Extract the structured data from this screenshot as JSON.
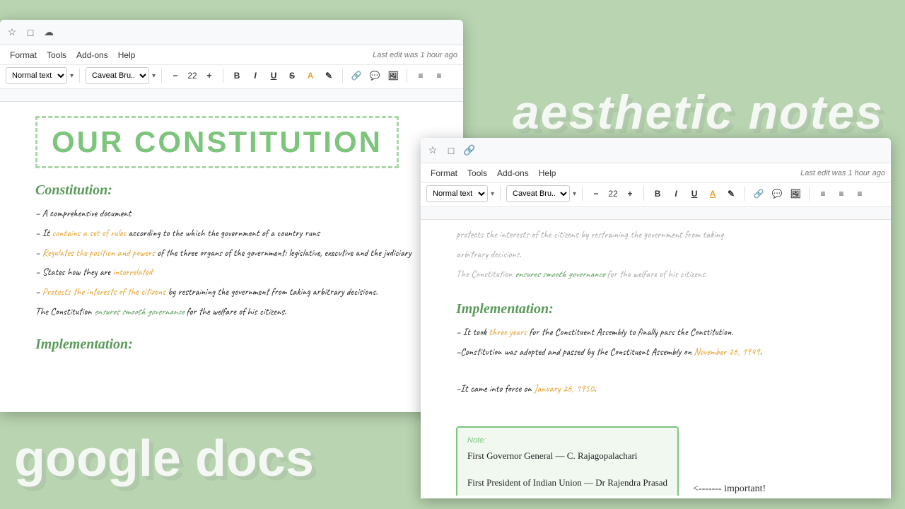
{
  "background": {
    "color": "#b8d4b0"
  },
  "decorative": {
    "aesthetic_notes": "aesthetic notes",
    "google_docs": "google docs",
    "arrow": "↗"
  },
  "window1": {
    "toolbar_icons": [
      "☆",
      "□",
      "☁"
    ],
    "menu_items": [
      "Format",
      "Tools",
      "Add-ons",
      "Help"
    ],
    "last_edit": "Last edit was 1 hour ago",
    "style_selector": "Normal text",
    "font_selector": "Caveat Bru...",
    "font_size": "22",
    "title": "OUR CONSTITUTION",
    "sections": [
      {
        "heading": "Constitution:",
        "content": [
          "– A comprehensive document",
          "– It {contains a set of rules} according to the which the government of a country runs",
          "– {Regulates the position and powers} of the three organs of the government: legislative, executive and the judiciary",
          "– States how they are {interrelated}",
          "– {Protects the interests of the citizens} by restraining the government from taking arbitrary decisions.",
          "The Constitution {ensures smooth governance} for the welfare of his citizens."
        ]
      },
      {
        "heading": "Implementation:"
      }
    ]
  },
  "window2": {
    "toolbar_icons": [
      "☆",
      "□",
      "🔗"
    ],
    "menu_items": [
      "Format",
      "Tools",
      "Add-ons",
      "Help"
    ],
    "last_edit": "Last edit was 1 hour ago",
    "style_selector": "Normal text",
    "font_selector": "Caveat Bru...",
    "font_size": "22",
    "sections": [
      {
        "heading": "Implementation:",
        "content": [
          "– It took {three years} for the Constituent Assembly to finally pass the Constitution.",
          "–Constitution was adopted and passed by the Constituent Assembly on {November 26, 1949}.",
          "–It came into force on {January 26, 1950}."
        ]
      }
    ],
    "note_box": {
      "label": "Note:",
      "lines": [
        "First Governor General — C. Rajagopalachari",
        "",
        "First President of Indian Union — Dr Rajendra Prasad"
      ]
    },
    "important_text": "<------- important!"
  }
}
